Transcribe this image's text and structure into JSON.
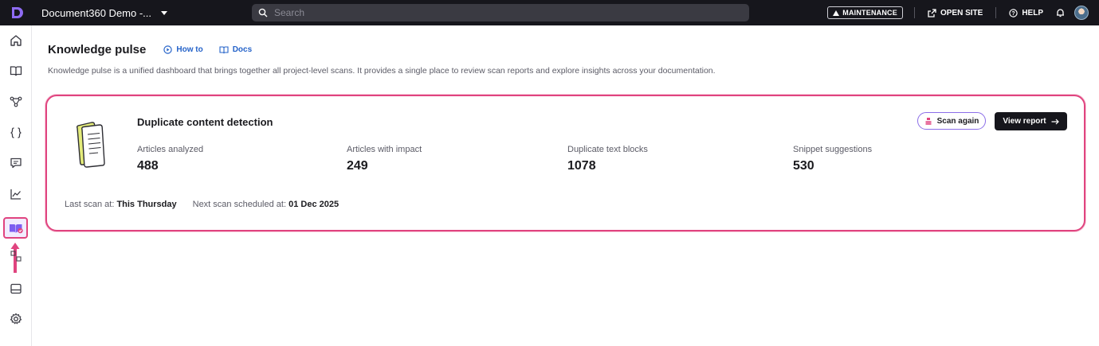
{
  "topbar": {
    "project_name": "Document360 Demo -...",
    "search_placeholder": "Search",
    "maintenance_label": "MAINTENANCE",
    "open_site_label": "OPEN SITE",
    "help_label": "HELP"
  },
  "sidebar": {
    "items": [
      {
        "name": "home-icon"
      },
      {
        "name": "documentation-icon"
      },
      {
        "name": "workflow-icon"
      },
      {
        "name": "api-icon"
      },
      {
        "name": "feedback-icon"
      },
      {
        "name": "analytics-icon"
      },
      {
        "name": "knowledge-pulse-icon",
        "active": true
      },
      {
        "name": "integrations-icon"
      },
      {
        "name": "widgets-icon"
      },
      {
        "name": "settings-icon"
      }
    ]
  },
  "page": {
    "title": "Knowledge pulse",
    "how_to_label": "How to",
    "docs_label": "Docs",
    "description": "Knowledge pulse is a unified dashboard that brings together all project-level scans. It provides a single place to review scan reports and explore insights across your documentation."
  },
  "card": {
    "title": "Duplicate content detection",
    "scan_again_label": "Scan again",
    "view_report_label": "View report",
    "stats": [
      {
        "label": "Articles analyzed",
        "value": "488"
      },
      {
        "label": "Articles with impact",
        "value": "249"
      },
      {
        "label": "Duplicate text blocks",
        "value": "1078"
      },
      {
        "label": "Snippet suggestions",
        "value": "530"
      }
    ],
    "last_scan_label": "Last scan at:",
    "last_scan_value": "This Thursday",
    "next_scan_label": "Next scan scheduled at:",
    "next_scan_value": "01 Dec 2025"
  },
  "colors": {
    "topbar_bg": "#16161c",
    "highlight": "#e0447f",
    "link": "#2563c9",
    "accent_purple": "#8b6ee8"
  }
}
